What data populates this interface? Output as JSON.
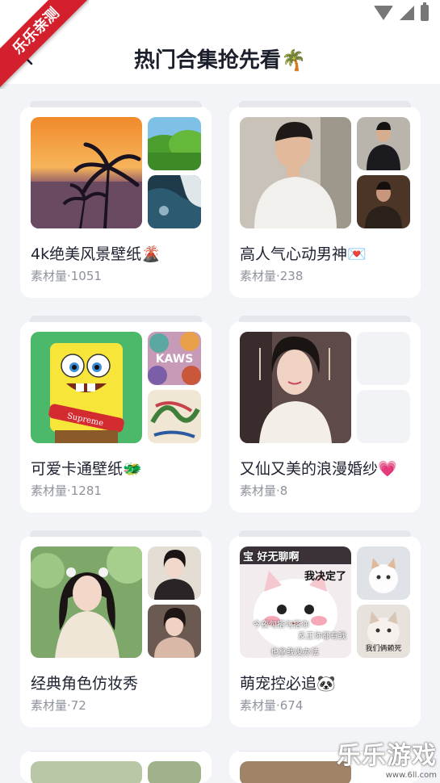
{
  "corner_badge": "乐乐亲测",
  "header": {
    "title": "热门合集抢先看",
    "title_emoji": "🌴"
  },
  "cards": [
    {
      "title": "4k绝美风景壁纸🌋",
      "count": "素材量·1051"
    },
    {
      "title": "高人气心动男神💌",
      "count": "素材量·238"
    },
    {
      "title": "可爱卡通壁纸🐲",
      "count": "素材量·1281"
    },
    {
      "title": "又仙又美的浪漫婚纱💗",
      "count": "素材量·8"
    },
    {
      "title": "经典角色仿妆秀",
      "count": "素材量·72"
    },
    {
      "title": "萌宠控必追🐼",
      "count": "素材量·674"
    }
  ],
  "meme_texts": [
    "宝 好无聊啊",
    "我决定了",
    "今夜勾搭勾搭你",
    "反正你都有我",
    "也拿我没办法",
    "我们俩赖死"
  ],
  "watermark": {
    "main": "乐乐游戏",
    "sub": "www.6ll.com"
  },
  "icons": {
    "back": "back-arrow-icon",
    "wifi": "wifi-icon",
    "signal": "signal-icon",
    "battery": "battery-icon"
  },
  "colors": {
    "ribbon": "#d4202c",
    "background": "#f3f4f8",
    "card": "#ffffff",
    "title": "#1b1e2b",
    "count": "#8e929c"
  }
}
